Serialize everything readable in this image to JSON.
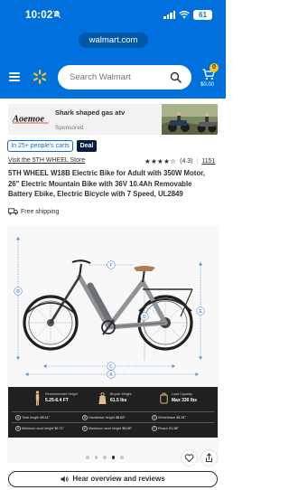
{
  "status_bar": {
    "time": "10:02",
    "battery": "61"
  },
  "browser": {
    "url": "walmart.com"
  },
  "header": {
    "search_placeholder": "Search Walmart",
    "cart_count": "0",
    "cart_total": "$0.00"
  },
  "ad": {
    "brand": "Aoemoe",
    "title": "Shark shaped gas atv",
    "sponsored_label": "Sponsored"
  },
  "tags": {
    "carts": "In 25+ people's carts",
    "deal": "Deal"
  },
  "product": {
    "store_link": "Visit the 5TH WHEEL Store",
    "stars": "★★★★☆",
    "rating": "(4.3)",
    "separator": "|",
    "review_count": "1151",
    "title": "5TH WHEEL W18B Electric Bike for Adult with 350W Motor, 26\" Electric Mountain Bike with 36V 10.4Ah Removable Battery Ebike, Electric Bicycle with 7 Speed, UL2849",
    "shipping": "Free shipping"
  },
  "figure": {
    "dimension_letters": [
      "A",
      "B",
      "C",
      "D",
      "E",
      "F"
    ],
    "specs_top": [
      {
        "label": "Recommended Height",
        "value": "5.25-6.4 FT"
      },
      {
        "label": "Bicycle Weight",
        "value": "61.5 lbs"
      },
      {
        "label": "Load Capacity",
        "value": "Max 330 lbs"
      }
    ],
    "specs_rows": [
      [
        {
          "letter": "A",
          "label": "Total length",
          "value": "69.11\""
        },
        {
          "letter": "B",
          "label": "Handlebar height",
          "value": "38.82\""
        },
        {
          "letter": "C",
          "label": "Wheelbase",
          "value": "43.31\""
        }
      ],
      [
        {
          "letter": "D",
          "label": "Minimum seat height",
          "value": "30.71\""
        },
        {
          "letter": "E",
          "label": "Maximum seat height",
          "value": "36.06\""
        },
        {
          "letter": "F",
          "label": "Reach",
          "value": "21.26\""
        }
      ]
    ]
  },
  "gallery": {
    "total_pages": 5,
    "active_page": 4
  },
  "actions": {
    "hear_overview": "Hear overview and reviews"
  },
  "colors": {
    "walmart_blue": "#0071dc",
    "spark_yellow": "#ffc220",
    "deal_navy": "#041e42"
  }
}
